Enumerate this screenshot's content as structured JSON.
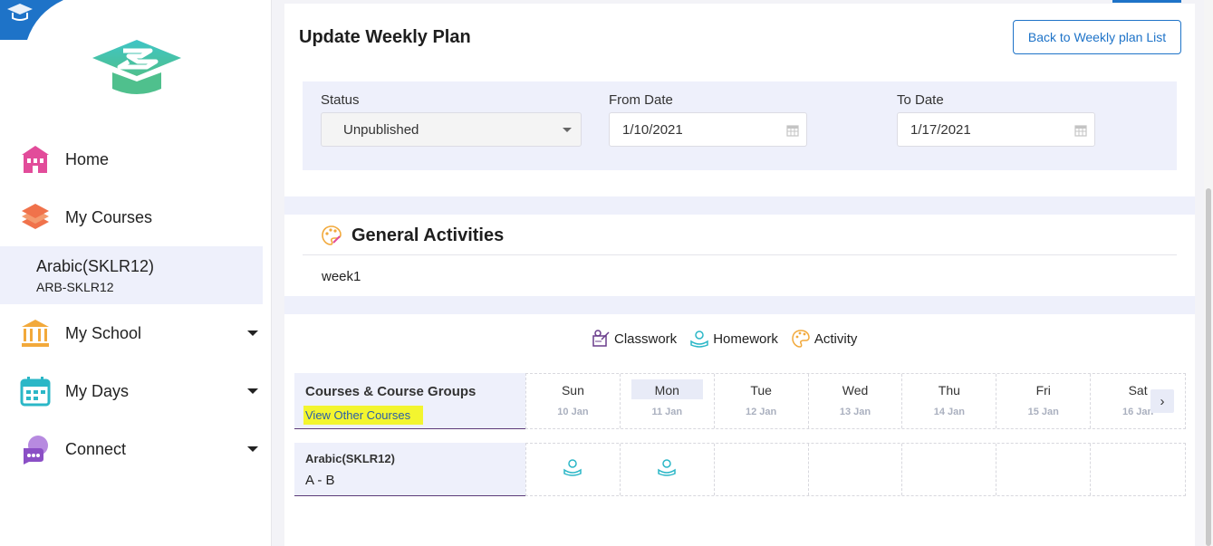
{
  "sidebar": {
    "items": [
      {
        "label": "Home",
        "icon": "school-building-icon",
        "color": "#e24c9a"
      },
      {
        "label": "My Courses",
        "icon": "book-stack-icon",
        "color": "#f0724b"
      },
      {
        "label": "My School",
        "icon": "institution-icon",
        "color": "#f2a93b"
      },
      {
        "label": "My Days",
        "icon": "calendar-icon",
        "color": "#2bb7c7"
      },
      {
        "label": "Connect",
        "icon": "chat-bubbles-icon",
        "color": "#8b4fc6"
      }
    ],
    "active_course": {
      "title": "Arabic(SKLR12)",
      "code": "ARB-SKLR12"
    }
  },
  "header": {
    "title": "Update Weekly Plan",
    "back_label": "Back to Weekly plan List"
  },
  "filters": {
    "status_label": "Status",
    "status_value": "Unpublished",
    "from_label": "From Date",
    "from_value": "1/10/2021",
    "to_label": "To Date",
    "to_value": "1/17/2021"
  },
  "general": {
    "title": "General Activities",
    "text": "week1"
  },
  "legend": [
    "Classwork",
    "Homework",
    "Activity"
  ],
  "grid": {
    "header_title": "Courses & Course Groups",
    "view_other": "View Other Courses",
    "days": [
      {
        "name": "Sun",
        "date": "10 Jan"
      },
      {
        "name": "Mon",
        "date": "11 Jan"
      },
      {
        "name": "Tue",
        "date": "12 Jan"
      },
      {
        "name": "Wed",
        "date": "13 Jan"
      },
      {
        "name": "Thu",
        "date": "14 Jan"
      },
      {
        "name": "Fri",
        "date": "15 Jan"
      },
      {
        "name": "Sat",
        "date": "16 Jan"
      }
    ],
    "selected_day": "Mon",
    "next_icon": "chevron-right-icon",
    "course": {
      "title": "Arabic(SKLR12)",
      "subtitle": "A - B"
    },
    "homework_days": [
      "Sun",
      "Mon"
    ]
  },
  "colors": {
    "accent": "#1e73c8",
    "panel": "#eef0fb",
    "highlight": "#f3f52f",
    "homework": "#2bb7c7",
    "activity": "#f2a93b",
    "classwork": "#6a3d8c"
  }
}
